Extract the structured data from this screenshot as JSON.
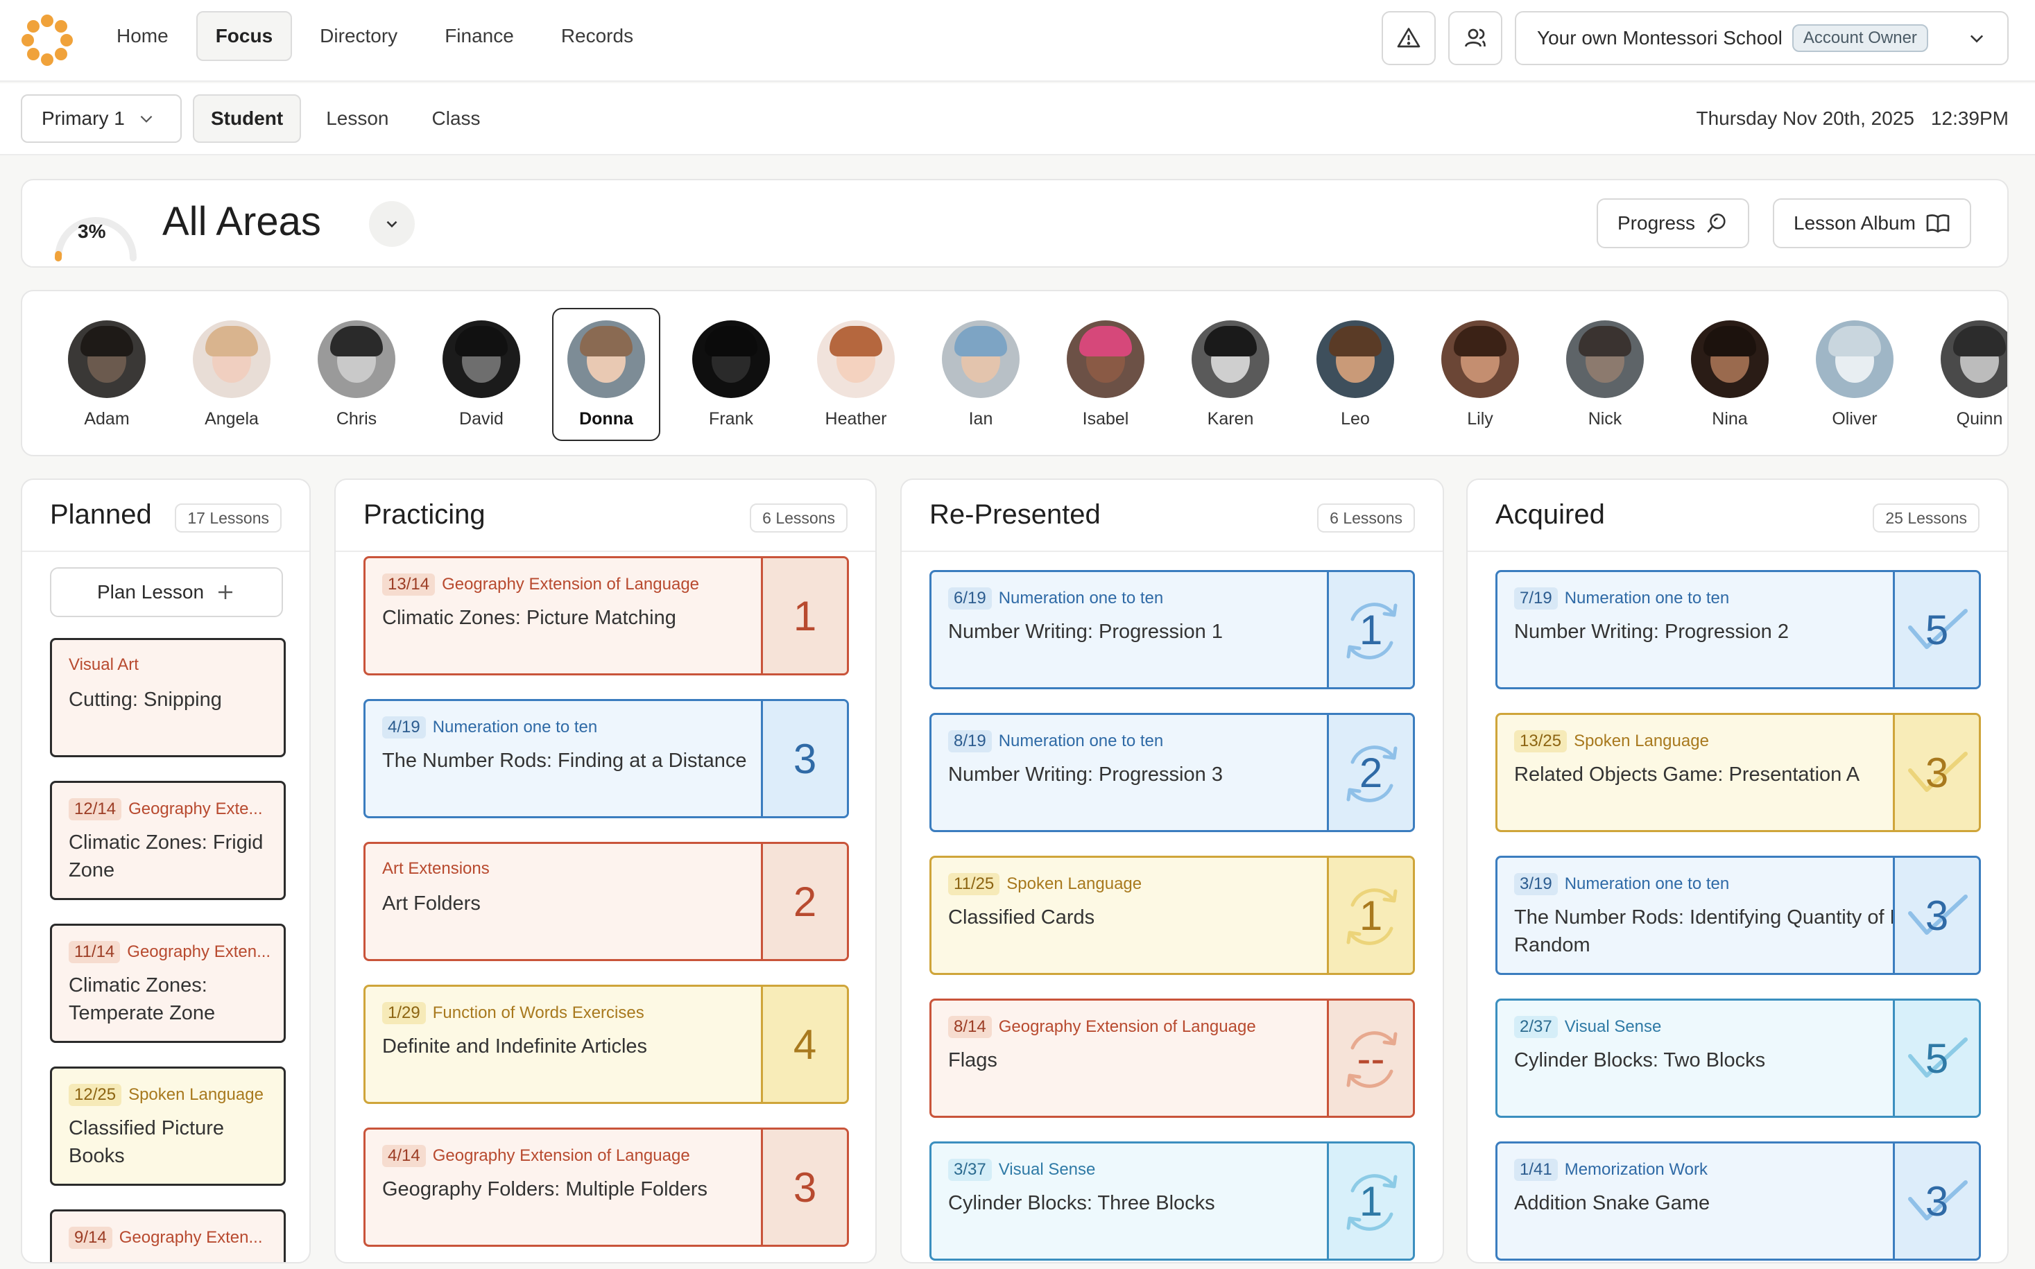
{
  "nav": {
    "items": [
      "Home",
      "Focus",
      "Directory",
      "Finance",
      "Records"
    ],
    "school": "Your own Montessori School",
    "role_badge": "Account Owner"
  },
  "subnav": {
    "class": "Primary 1",
    "tabs": [
      "Student",
      "Lesson",
      "Class"
    ],
    "date": "Thursday Nov 20th, 2025",
    "time": "12:39PM"
  },
  "area": {
    "progress": "3%",
    "progress_value": 0.03,
    "title": "All Areas",
    "progress_button": "Progress",
    "album_button": "Lesson Album"
  },
  "students": [
    {
      "name": "Adam",
      "skin": "#6b5a4e",
      "hair": "#1e1a17",
      "bg": "#3a3836"
    },
    {
      "name": "Angela",
      "skin": "#f0cfc0",
      "hair": "#d9b48e",
      "bg": "#e8ddd6"
    },
    {
      "name": "Chris",
      "skin": "#c9c9c9",
      "hair": "#2a2a2a",
      "bg": "#9a9a9a"
    },
    {
      "name": "David",
      "skin": "#6e6e6e",
      "hair": "#111111",
      "bg": "#1b1b1b"
    },
    {
      "name": "Donna",
      "skin": "#e9c9b3",
      "hair": "#8a6a52",
      "bg": "#7d8c96"
    },
    {
      "name": "Frank",
      "skin": "#2a2a2a",
      "hair": "#0b0b0b",
      "bg": "#0f0f0f"
    },
    {
      "name": "Heather",
      "skin": "#f4d2bf",
      "hair": "#b5673e",
      "bg": "#f1e3dc"
    },
    {
      "name": "Ian",
      "skin": "#e3c4ad",
      "hair": "#7da4c4",
      "bg": "#b8c0c6"
    },
    {
      "name": "Isabel",
      "skin": "#8a5a45",
      "hair": "#d6487a",
      "bg": "#6c5146"
    },
    {
      "name": "Karen",
      "skin": "#cfcfcf",
      "hair": "#1a1a1a",
      "bg": "#5a5a5a"
    },
    {
      "name": "Leo",
      "skin": "#c99a78",
      "hair": "#5a3b26",
      "bg": "#3e4f5c"
    },
    {
      "name": "Lily",
      "skin": "#c48e70",
      "hair": "#3b2216",
      "bg": "#6b4636"
    },
    {
      "name": "Nick",
      "skin": "#8c7a6e",
      "hair": "#3a3330",
      "bg": "#5e6468"
    },
    {
      "name": "Nina",
      "skin": "#9a6a4e",
      "hair": "#1c120d",
      "bg": "#2a1c16"
    },
    {
      "name": "Oliver",
      "skin": "#e8eef2",
      "hair": "#c9d6de",
      "bg": "#9fb6c6"
    },
    {
      "name": "Quinn",
      "skin": "#bcbcbc",
      "hair": "#2c2c2c",
      "bg": "#4a4a4a"
    }
  ],
  "active_student": "Donna",
  "columns": {
    "planned": {
      "title": "Planned",
      "count": "17 Lessons",
      "plan_button": "Plan Lesson",
      "lessons": [
        {
          "frac": "",
          "area": "Visual Art",
          "name": "Cutting: Snipping",
          "color": "orange"
        },
        {
          "frac": "12/14",
          "area": "Geography Exte...",
          "name": "Climatic Zones: Frigid Zone",
          "color": "orange"
        },
        {
          "frac": "11/14",
          "area": "Geography Exten...",
          "name": "Climatic Zones: Temperate Zone",
          "color": "orange"
        },
        {
          "frac": "12/25",
          "area": "Spoken Language",
          "name": "Classified Picture Books",
          "color": "yellow"
        },
        {
          "frac": "9/14",
          "area": "Geography Exten...",
          "name": "",
          "color": "orange"
        }
      ]
    },
    "practicing": {
      "title": "Practicing",
      "count": "6 Lessons",
      "lessons": [
        {
          "frac": "13/14",
          "area": "Geography Extension of Language",
          "name": "Climatic Zones: Picture Matching",
          "count": "1",
          "color": "orange"
        },
        {
          "frac": "4/19",
          "area": "Numeration one to ten",
          "name": "The Number Rods: Finding at a Distance",
          "count": "3",
          "color": "blue"
        },
        {
          "frac": "",
          "area": "Art Extensions",
          "name": "Art Folders",
          "count": "2",
          "color": "orange"
        },
        {
          "frac": "1/29",
          "area": "Function of Words Exercises",
          "name": "Definite and Indefinite Articles",
          "count": "4",
          "color": "yellow"
        },
        {
          "frac": "4/14",
          "area": "Geography Extension of Language",
          "name": "Geography Folders: Multiple Folders",
          "count": "3",
          "color": "orange"
        }
      ]
    },
    "represented": {
      "title": "Re-Presented",
      "count": "6 Lessons",
      "lessons": [
        {
          "frac": "6/19",
          "area": "Numeration one to ten",
          "name": "Number Writing: Progression 1",
          "count": "1",
          "color": "blue"
        },
        {
          "frac": "8/19",
          "area": "Numeration one to ten",
          "name": "Number Writing: Progression 3",
          "count": "2",
          "color": "blue"
        },
        {
          "frac": "11/25",
          "area": "Spoken Language",
          "name": "Classified Cards",
          "count": "1",
          "color": "yellow"
        },
        {
          "frac": "8/14",
          "area": "Geography Extension of Language",
          "name": "Flags",
          "count": "--",
          "color": "orange"
        },
        {
          "frac": "3/37",
          "area": "Visual Sense",
          "name": "Cylinder Blocks: Three Blocks",
          "count": "1",
          "color": "cyan"
        }
      ]
    },
    "acquired": {
      "title": "Acquired",
      "count": "25 Lessons",
      "lessons": [
        {
          "frac": "7/19",
          "area": "Numeration one to ten",
          "name": "Number Writing: Progression 2",
          "count": "5",
          "color": "blue"
        },
        {
          "frac": "13/25",
          "area": "Spoken Language",
          "name": "Related Objects Game: Presentation A",
          "count": "3",
          "color": "yellow"
        },
        {
          "frac": "3/19",
          "area": "Numeration one to ten",
          "name": "The Number Rods: Identifying Quantity of Rod at Random",
          "count": "3",
          "color": "blue"
        },
        {
          "frac": "2/37",
          "area": "Visual Sense",
          "name": "Cylinder Blocks: Two Blocks",
          "count": "5",
          "color": "cyan"
        },
        {
          "frac": "1/41",
          "area": "Memorization Work",
          "name": "Addition Snake Game",
          "count": "3",
          "color": "blue"
        }
      ]
    }
  }
}
